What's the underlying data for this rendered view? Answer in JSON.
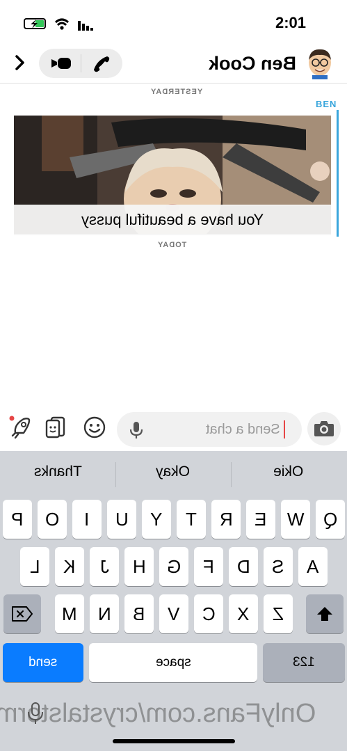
{
  "status": {
    "time": "2:01",
    "icons": [
      "battery-charging-icon",
      "wifi-icon",
      "signal-icon"
    ]
  },
  "header": {
    "contact_name": "Ben Cook",
    "back_icon": "chevron-right-icon",
    "video_icon": "video-camera-icon",
    "phone_icon": "phone-icon",
    "avatar_icon": "bitmoji-avatar-icon"
  },
  "chat": {
    "date_yesterday": "YESTERDAY",
    "sender": "BEN",
    "snap_caption": "You have a beautiful pussy",
    "date_today": "TODAY",
    "accent": "#3aa6dc"
  },
  "composer": {
    "placeholder": "Send a chat",
    "bitmoji_icon": "rocket-bitmoji-icon",
    "sticker_icon": "sticker-cards-icon",
    "emoji_icon": "smiley-icon",
    "mic_icon": "microphone-icon",
    "camera_icon": "camera-icon"
  },
  "keyboard": {
    "suggestions": [
      "Okie",
      "Okay",
      "Thanks"
    ],
    "row1": [
      "Q",
      "W",
      "E",
      "R",
      "T",
      "Y",
      "U",
      "I",
      "O",
      "P"
    ],
    "row2": [
      "A",
      "S",
      "D",
      "F",
      "G",
      "H",
      "J",
      "K",
      "L"
    ],
    "row3": [
      "Z",
      "X",
      "C",
      "V",
      "B",
      "N",
      "M"
    ],
    "numbers_label": "123",
    "space_label": "space",
    "send_label": "send",
    "shift_icon": "shift-arrow-icon",
    "delete_icon": "backspace-icon",
    "send_color": "#0a7cff"
  },
  "watermark": "OnlyFans.com/crystalstorm"
}
